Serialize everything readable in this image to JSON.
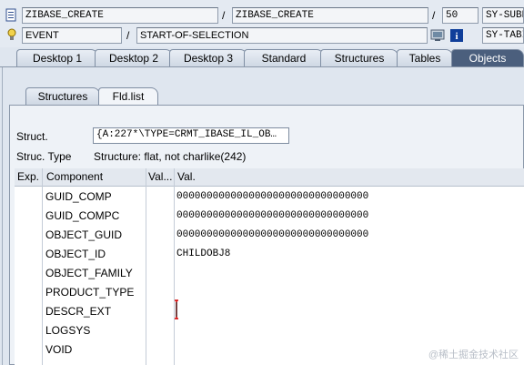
{
  "header": {
    "row1": {
      "program_field_1": "ZIBASE_CREATE",
      "program_field_2": "ZIBASE_CREATE",
      "line_number": "50",
      "right_field": "SY-SUBRC"
    },
    "row2": {
      "event_field": "EVENT",
      "event_value": "START-OF-SELECTION",
      "right_field": "SY-TABIX"
    }
  },
  "top_tabs": [
    "Desktop 1",
    "Desktop 2",
    "Desktop 3",
    "Standard",
    "Structures",
    "Tables",
    "Objects"
  ],
  "active_top_tab": "Objects",
  "inner_tabs": [
    "Structures",
    "Fld.list"
  ],
  "active_inner_tab": "Fld.list",
  "struct": {
    "label": "Struct.",
    "value": "{A:227*\\TYPE=CRMT_IBASE_IL_OB…",
    "type_label": "Struc. Type",
    "type_value": "Structure: flat, not charlike(242)"
  },
  "table": {
    "headers": [
      "Exp.",
      "Component",
      "Val...",
      "Val."
    ],
    "rows": [
      {
        "component": "GUID_COMP",
        "value": "00000000000000000000000000000000"
      },
      {
        "component": "GUID_COMPC",
        "value": "00000000000000000000000000000000"
      },
      {
        "component": "OBJECT_GUID",
        "value": "00000000000000000000000000000000"
      },
      {
        "component": "OBJECT_ID",
        "value": "CHILDOBJ8"
      },
      {
        "component": "OBJECT_FAMILY",
        "value": ""
      },
      {
        "component": "PRODUCT_TYPE",
        "value": ""
      },
      {
        "component": "DESCR_EXT",
        "value": ""
      },
      {
        "component": "LOGSYS",
        "value": ""
      },
      {
        "component": "VOID",
        "value": ""
      }
    ]
  },
  "watermark": "@稀土掘金技术社区"
}
